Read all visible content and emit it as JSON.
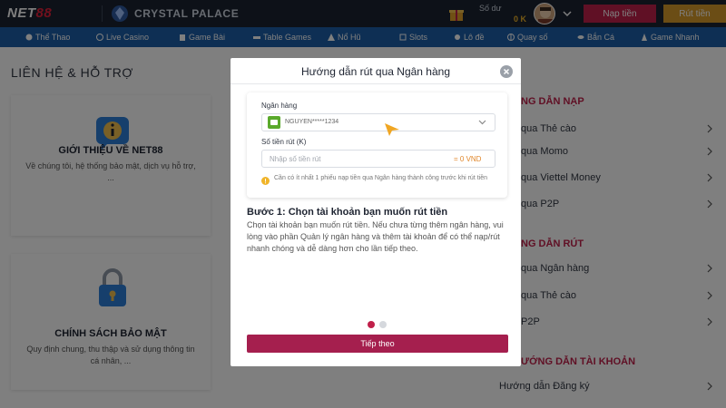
{
  "header": {
    "logo_main": "NET",
    "logo_accent": "88",
    "brand": "CRYSTAL PALACE",
    "balance_label": "Số dư",
    "balance_value": "0 K",
    "deposit_label": "Nạp tiền",
    "withdraw_label": "Rút tiền"
  },
  "nav": [
    {
      "label": "Thể Thao",
      "icon": "soccer-icon"
    },
    {
      "label": "Live Casino",
      "icon": "chip-icon"
    },
    {
      "label": "Game Bài",
      "icon": "cards-icon"
    },
    {
      "label": "Table Games",
      "icon": "table-icon"
    },
    {
      "label": "Nổ Hũ",
      "icon": "jackpot-icon"
    },
    {
      "label": "Slots",
      "icon": "slots-icon"
    },
    {
      "label": "Lô đề",
      "icon": "lottery-icon"
    },
    {
      "label": "Quay số",
      "icon": "wheel-icon"
    },
    {
      "label": "Bắn Cá",
      "icon": "fish-icon"
    },
    {
      "label": "Game Nhanh",
      "icon": "rocket-icon"
    }
  ],
  "left": {
    "title": "LIÊN HỆ & HỖ TRỢ",
    "cards": [
      {
        "title": "GIỚI THIỆU VỀ NET88",
        "desc": "Về chúng tôi, hệ thống bảo mật, dịch vụ hỗ trợ, ...",
        "icon": "info-chat-icon"
      },
      {
        "title": "CHÍNH SÁCH BẢO MẬT",
        "desc": "Quy định chung, thu thập và sử dụng thông tin cá nhân, ...",
        "icon": "padlock-icon"
      }
    ]
  },
  "right": {
    "section1": "NG DẪN NẠP",
    "items1": [
      "qua Thẻ cào",
      "qua Momo",
      "qua Viettel Money",
      "qua P2P"
    ],
    "section2": "NG DẪN RÚT",
    "items2": [
      "qua Ngân hàng",
      "qua Thẻ cào",
      "P2P"
    ],
    "section3": "ƯỚNG DẪN TÀI KHOẢN",
    "items3": [
      "Hướng dẫn Đăng ký"
    ]
  },
  "modal": {
    "title": "Hướng dẫn rút qua Ngân hàng",
    "bank_label": "Ngân hàng",
    "bank_value": "NGUYEN*****1234",
    "amount_label": "Số tiền rút (K)",
    "amount_placeholder": "Nhập số tiền rút",
    "amount_unit": "= 0 VND",
    "note": "Cần có ít nhất 1 phiếu nạp tiền qua Ngân hàng thành công trước khi rút tiền",
    "step_title": "Bước 1: Chọn tài khoản bạn muốn rút tiền",
    "step_desc": "Chọn tài khoản bạn muốn rút tiền. Nếu chưa từng thêm ngân hàng, vui lòng vào phần Quản lý ngân hàng và thêm tài khoản để có thể nạp/rút nhanh chóng và dễ dàng hơn cho lần tiếp theo.",
    "next_label": "Tiếp theo",
    "pagination": {
      "current": 1,
      "total": 2
    }
  },
  "colors": {
    "header_bg": "#1b2330",
    "nav_bg": "#1d5fa8",
    "accent_red": "#c0204a",
    "accent_gold": "#d79b2a",
    "modal_button": "#a51f4e",
    "bank_logo": "#5aa92b"
  }
}
